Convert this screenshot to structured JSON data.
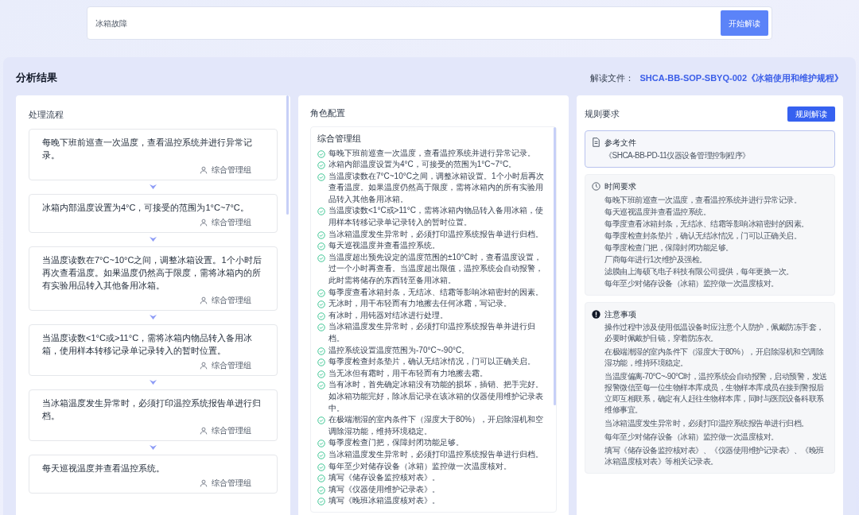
{
  "search": {
    "value": "冰箱故障",
    "button": "开始解读"
  },
  "result": {
    "title": "分析结果",
    "file_label": "解读文件：",
    "file_name": "SHCA-BB-SOP-SBYQ-002《冰箱使用和维护规程》"
  },
  "process": {
    "title": "处理流程",
    "steps": [
      {
        "text": "每晚下班前巡查一次温度，查看温控系统并进行异常记录。",
        "role": "综合管理组"
      },
      {
        "text": "冰箱内部温度设置为4°C，可接受的范围为1°C~7°C。",
        "role": "综合管理组"
      },
      {
        "text": "当温度读数在7°C~10°C之间，调整冰箱设置。1个小时后再次查看温度。如果温度仍然高于限度，需将冰箱内的所有实验用品转入其他备用冰箱。",
        "role": "综合管理组"
      },
      {
        "text": "当温度读数<1°C或>11°C，需将冰箱内物品转入备用冰箱，使用样本转移记录单记录转入的暂时位置。",
        "role": "综合管理组"
      },
      {
        "text": "当冰箱温度发生异常时，必须打印温控系统报告单进行归档。",
        "role": "综合管理组"
      },
      {
        "text": "每天巡视温度并查看温控系统。",
        "role": "综合管理组"
      }
    ]
  },
  "roles": {
    "title": "角色配置",
    "groups": [
      {
        "name": "综合管理组",
        "items": [
          "每晚下班前巡查一次温度，查看温控系统并进行异常记录。",
          "冰箱内部温度设置为4°C，可接受的范围为1°C~7°C。",
          "当温度读数在7°C~10°C之间，调整冰箱设置。1个小时后再次查看温度。如果温度仍然高于限度，需将冰箱内的所有实验用品转入其他备用冰箱。",
          "当温度读数<1°C或>11°C，需将冰箱内物品转入备用冰箱，使用样本转移记录单记录转入的暂时位置。",
          "当冰箱温度发生异常时，必须打印温控系统报告单进行归档。",
          "每天巡视温度并查看温控系统。",
          "当温度超出预先设定的温度范围的±10°C时，查看温度设置，过一个小时再查看。当温度超出限值，温控系统会自动报警，此时需将储存的东西转至备用冰箱。",
          "每季度查看冰箱封条，无结冰、结霜等影响冰箱密封的因素。",
          "无冰时，用干布轻而有力地擦去任何冰霜，写记录。",
          "有冰时，用钝器对结冰进行处理。",
          "当冰箱温度发生异常时，必须打印温控系统报告单并进行归档。",
          "温控系统设置温度范围为-70°C~-90°C。",
          "每季度检查封条垫片，确认无结冰情况，门可以正确关启。",
          "当无冰但有霜时，用干布轻而有力地擦去霜。",
          "当有冰时，首先确定冰箱没有功能的损坏，插销、把手完好。如冰箱功能完好，除冰后记录在该冰箱的仪器使用维护记录表中。",
          "在极端潮湿的室内条件下（湿度大于80%），开启除湿机和空调除湿功能，维持环境稳定。",
          "每季度检查门把，保障封闭功能足够。",
          "当冰箱温度发生异常时，必须打印温控系统报告单进行归档。",
          "每年至少对储存设备（冰箱）监控做一次温度核对。",
          "填写《储存设备监控核对表》。",
          "填写《仪器使用维护记录表》。",
          "填写《晚班冰箱温度核对表》。"
        ]
      }
    ]
  },
  "rules": {
    "title": "规则要求",
    "button": "规则解读",
    "sections": [
      {
        "kind": "reference",
        "title": "参考文件",
        "lines": [
          "《SHCA-BB-PD-11仪器设备管理控制程序》"
        ]
      },
      {
        "kind": "time",
        "title": "时间要求",
        "lines": [
          "每晚下班前巡查一次温度，查看温控系统并进行异常记录。",
          "每天巡视温度并查看温控系统。",
          "每季度查看冰箱封条，无结冰、结霜等影响冰箱密封的因素。",
          "每季度检查封条垫片，确认无结冰情况，门可以正确关启。",
          "每季度检查门把，保障封闭功能足够。",
          "厂商每年进行1次维护及强检。",
          "滤膜由上海硕飞电子科技有限公司提供，每年更换一次。",
          "每年至少对储存设备（冰箱）监控做一次温度核对。"
        ]
      },
      {
        "kind": "notice",
        "title": "注意事项",
        "lines": [
          "操作过程中涉及使用低温设备时应注意个人防护，佩戴防冻手套，必要时佩戴护目镜，穿着防冻衣。",
          "在极端潮湿的室内条件下（湿度大于80%），开启除湿机和空调除湿功能，维持环境稳定。",
          "当温度偏离-70°C~-90°C时，温控系统会自动报警，启动预警，发送报警微信至每一位生物样本库成员，生物样本库成员在接到警报后立即互相联系，确定有人赶往生物样本库，同时与医院设备科联系维修事宜。",
          "当冰箱温度发生异常时，必须打印温控系统报告单进行归档。",
          "每年至少对储存设备（冰箱）监控做一次温度核对。",
          "填写《储存设备监控核对表》、《仪器使用维护记录表》、《晚班冰箱温度核对表》等相关记录表。"
        ]
      }
    ]
  }
}
